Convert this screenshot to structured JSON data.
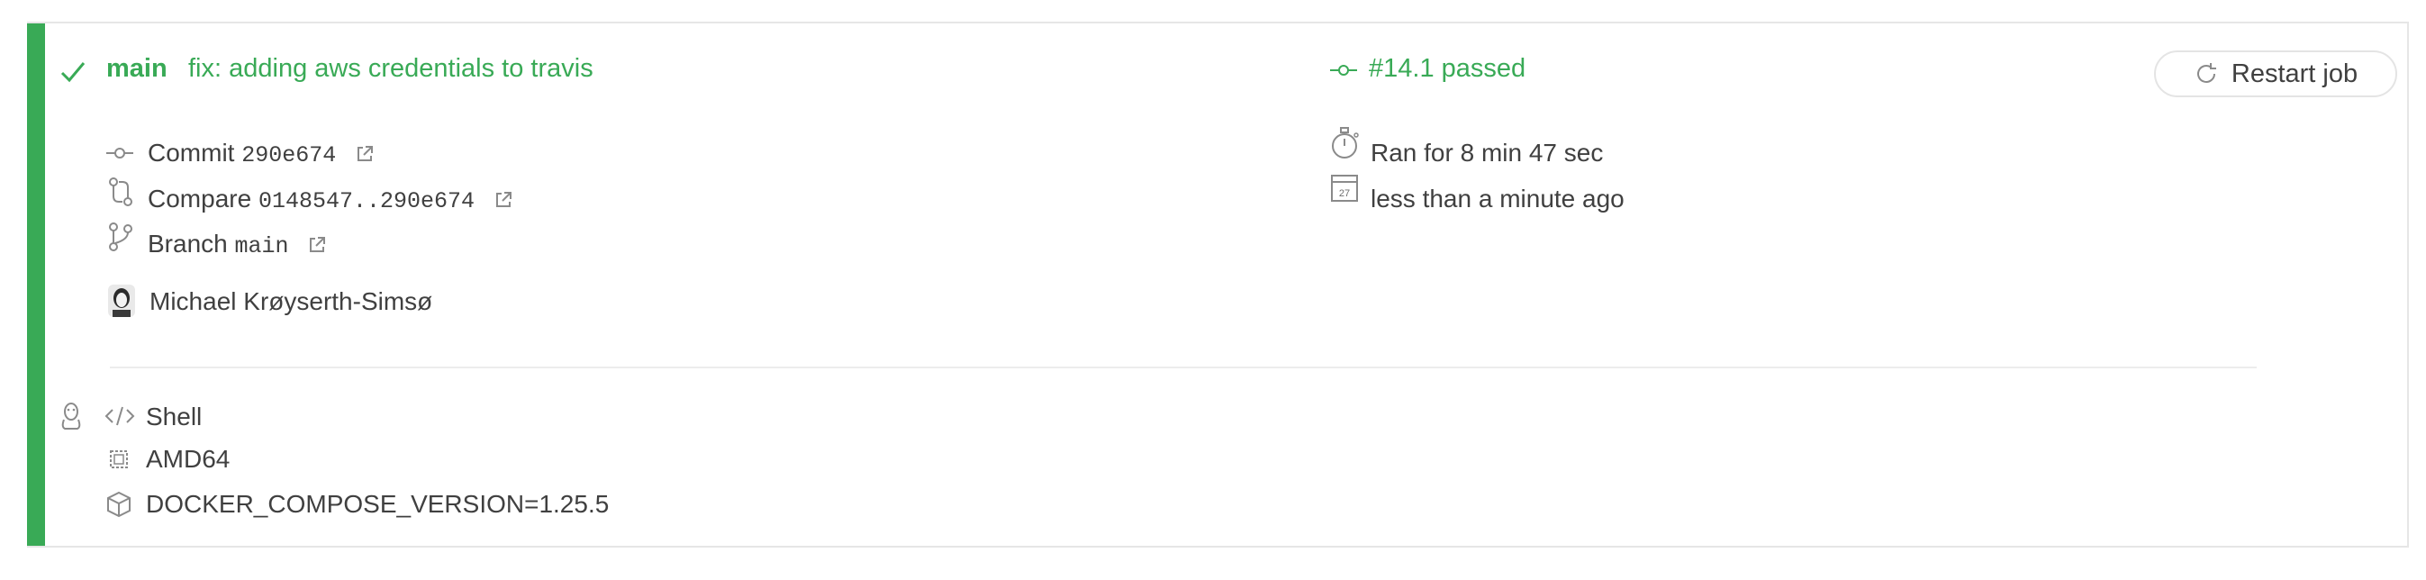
{
  "job": {
    "status_icon": "check-icon",
    "branch_name": "main",
    "commit_message": "fix: adding aws credentials to travis",
    "build_number_status": "#14.1 passed",
    "restart_label": "Restart job",
    "colors": {
      "passed": "#39aa56",
      "text": "#404040",
      "icon": "#8a8a8a"
    }
  },
  "details": {
    "commit_label": "Commit",
    "commit_sha": "290e674",
    "compare_label": "Compare",
    "compare_range": "0148547..290e674",
    "branch_label": "Branch",
    "branch_value": "main",
    "author": "Michael Krøyserth-Simsø"
  },
  "timing": {
    "duration": "Ran for 8 min 47 sec",
    "calendar_day": "27",
    "finished": "less than a minute ago"
  },
  "environment": {
    "os_icon": "linux-tux-icon",
    "language": "Shell",
    "arch": "AMD64",
    "env_var": "DOCKER_COMPOSE_VERSION=1.25.5"
  }
}
